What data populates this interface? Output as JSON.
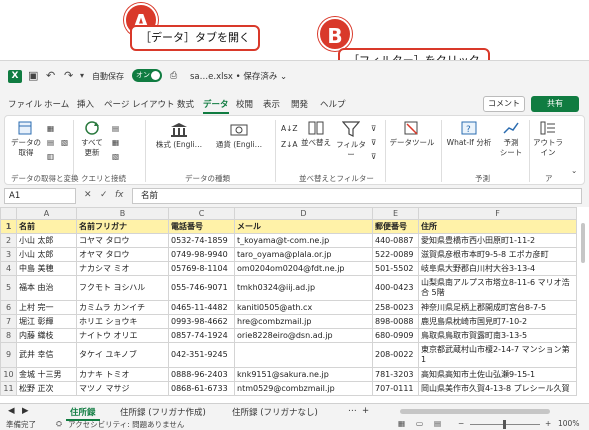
{
  "annotations": {
    "a": {
      "badge": "A",
      "text": "［データ］タブを開く"
    },
    "b": {
      "badge": "B",
      "text": "［フィルター］をクリック"
    }
  },
  "title": {
    "autosave": "自動保存",
    "toggle": "オン",
    "file": "sa…e.xlsx • 保存済み ⌄"
  },
  "menu": [
    "ファイル",
    "ホーム",
    "挿入",
    "ページ レイアウト",
    "数式",
    "データ",
    "校閲",
    "表示",
    "開発",
    "ヘルプ"
  ],
  "buttons": {
    "comment": "コメント",
    "share": "共有"
  },
  "ribbon": {
    "get_data": [
      "データの",
      "取得"
    ],
    "refresh": [
      "すべて",
      "更新"
    ],
    "stocks": "株式 (Engli…",
    "currency": "通貨 (Engli…",
    "sort": [
      "並べ替え"
    ],
    "filter": "フィルター",
    "data_tools": "データツール",
    "whatif": "What-If 分析",
    "forecast": [
      "予測",
      "シート"
    ],
    "outline": [
      "アウトラ",
      "イン"
    ],
    "groups": [
      "データの取得と変換",
      "クエリと接続",
      "データの種類",
      "並べ替えとフィルター",
      "予測",
      "ア"
    ]
  },
  "formula_bar": {
    "name_box": "A1",
    "fx": "fx",
    "content": "名前"
  },
  "columns": [
    "A",
    "B",
    "C",
    "D",
    "E",
    "F"
  ],
  "rows": [
    {
      "n": "1",
      "cells": [
        "名前",
        "名前フリガナ",
        "電話番号",
        "メール",
        "郵便番号",
        "住所"
      ],
      "header": true
    },
    {
      "n": "2",
      "cells": [
        "小山 太郎",
        "コヤマ タロウ",
        "0532-74-1859",
        "t_koyama@t-com.ne.jp",
        "440-0887",
        "愛知県豊橋市西小田原町1-11-2"
      ]
    },
    {
      "n": "3",
      "cells": [
        "小山 太郎",
        "オヤマ タロウ",
        "0749-98-9940",
        "taro_oyama@plala.or.jp",
        "522-0089",
        "滋賀県彦根市本町9-5-8 エポカ彦町"
      ]
    },
    {
      "n": "4",
      "cells": [
        "中島 美穂",
        "ナカシマ ミオ",
        "05769-8-1104",
        "om0204om0204@fdt.ne.jp",
        "501-5502",
        "岐阜県大野郡白川村大谷3-13-4"
      ]
    },
    {
      "n": "5",
      "cells": [
        "福本 由治",
        "フクモト ヨシハル",
        "055-746-9071",
        "tmkh0324@iij.ad.jp",
        "400-0423",
        "山梨県南アルプス市塔立8-11-6 マリオ浩合 5階"
      ],
      "tall": true
    },
    {
      "n": "6",
      "cells": [
        "上村 完一",
        "カミムラ カンイチ",
        "0465-11-4482",
        "kaniti0505@ath.cx",
        "258-0023",
        "神奈川県足柄上郡開成町宮台8-7-5"
      ]
    },
    {
      "n": "7",
      "cells": [
        "堀江 彰輝",
        "ホリエ ショウキ",
        "0993-98-4662",
        "hre@combzmail.jp",
        "898-0088",
        "鹿児島県枕崎市国見町7-10-2"
      ]
    },
    {
      "n": "8",
      "cells": [
        "内藤 織枝",
        "ナイトウ オリエ",
        "0857-74-1924",
        "orie8228eiro@dsn.ad.jp",
        "680-0909",
        "鳥取県鳥取市賀露町南3-13-5"
      ]
    },
    {
      "n": "9",
      "cells": [
        "武井 幸信",
        "タケイ ユキノブ",
        "042-351-9245",
        "",
        "208-0022",
        "東京都武蔵村山市榎2-14-7 マンション第1"
      ],
      "tall": true
    },
    {
      "n": "10",
      "cells": [
        "金城 十三男",
        "カナキ トミオ",
        "0888-96-2403",
        "knk9151@sakura.ne.jp",
        "781-3203",
        "高知県高知市土佐山弘瀬9-15-1"
      ]
    },
    {
      "n": "11",
      "cells": [
        "松野 正次",
        "マツノ マサジ",
        "0868-61-6733",
        "ntm0529@combzmail.jp",
        "707-0111",
        "岡山県美作市久賀4-13-8 プレシール久賀"
      ]
    }
  ],
  "sheets": [
    "住所録",
    "住所録 (フリガナ作成)",
    "住所録 (フリガナなし)"
  ],
  "status": {
    "ready": "準備完了",
    "accessibility": "アクセシビリティ: 問題ありません",
    "zoom": "100%"
  }
}
